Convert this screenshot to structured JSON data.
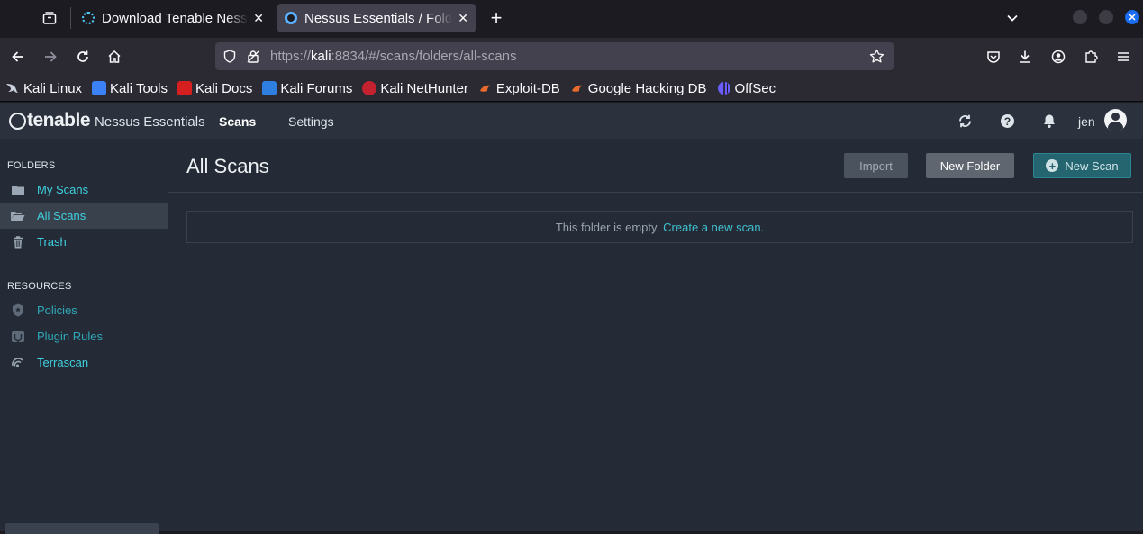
{
  "browser": {
    "tabs": [
      {
        "title": "Download Tenable Nessus",
        "close": "✕"
      },
      {
        "title": "Nessus Essentials / Folders / All Scans",
        "close": "✕"
      }
    ],
    "new_tab": "+",
    "url_scheme": "https://",
    "url_host": "kali",
    "url_rest": ":8834/#/scans/folders/all-scans",
    "bookmarks": [
      {
        "label": "Kali Linux",
        "icon": "kali-dragon-icon",
        "color": "#c9d1da"
      },
      {
        "label": "Kali Tools",
        "icon": "kali-tools-icon",
        "color": "#3b82f6"
      },
      {
        "label": "Kali Docs",
        "icon": "kali-docs-icon",
        "color": "#d61f1f"
      },
      {
        "label": "Kali Forums",
        "icon": "kali-forums-icon",
        "color": "#2f7fe0"
      },
      {
        "label": "Kali NetHunter",
        "icon": "nethunter-icon",
        "color": "#c3222e"
      },
      {
        "label": "Exploit-DB",
        "icon": "exploit-db-icon",
        "color": "#e86a2c"
      },
      {
        "label": "Google Hacking DB",
        "icon": "ghdb-icon",
        "color": "#e86a2c"
      },
      {
        "label": "OffSec",
        "icon": "offsec-icon",
        "color": "#6a5cff"
      }
    ]
  },
  "app": {
    "brand": "tenable",
    "product": "Nessus Essentials",
    "nav": {
      "scans": "Scans",
      "settings": "Settings"
    },
    "user": "jen"
  },
  "sidebar": {
    "folders_heading": "FOLDERS",
    "folders": [
      {
        "label": "My Scans",
        "icon": "folder-icon"
      },
      {
        "label": "All Scans",
        "icon": "folder-open-icon",
        "active": true
      },
      {
        "label": "Trash",
        "icon": "trash-icon"
      }
    ],
    "resources_heading": "RESOURCES",
    "resources": [
      {
        "label": "Policies",
        "icon": "shield-icon"
      },
      {
        "label": "Plugin Rules",
        "icon": "plugin-icon"
      },
      {
        "label": "Terrascan",
        "icon": "terrascan-icon"
      }
    ]
  },
  "main": {
    "title": "All Scans",
    "buttons": {
      "import": "Import",
      "new_folder": "New Folder",
      "new_scan": "New Scan"
    },
    "empty_text": "This folder is empty.",
    "empty_link": "Create a new scan."
  },
  "colors": {
    "accent": "#3fd0e0",
    "primary_button": "#24656f",
    "header_bg": "#2b323d",
    "content_bg": "#242b36"
  }
}
